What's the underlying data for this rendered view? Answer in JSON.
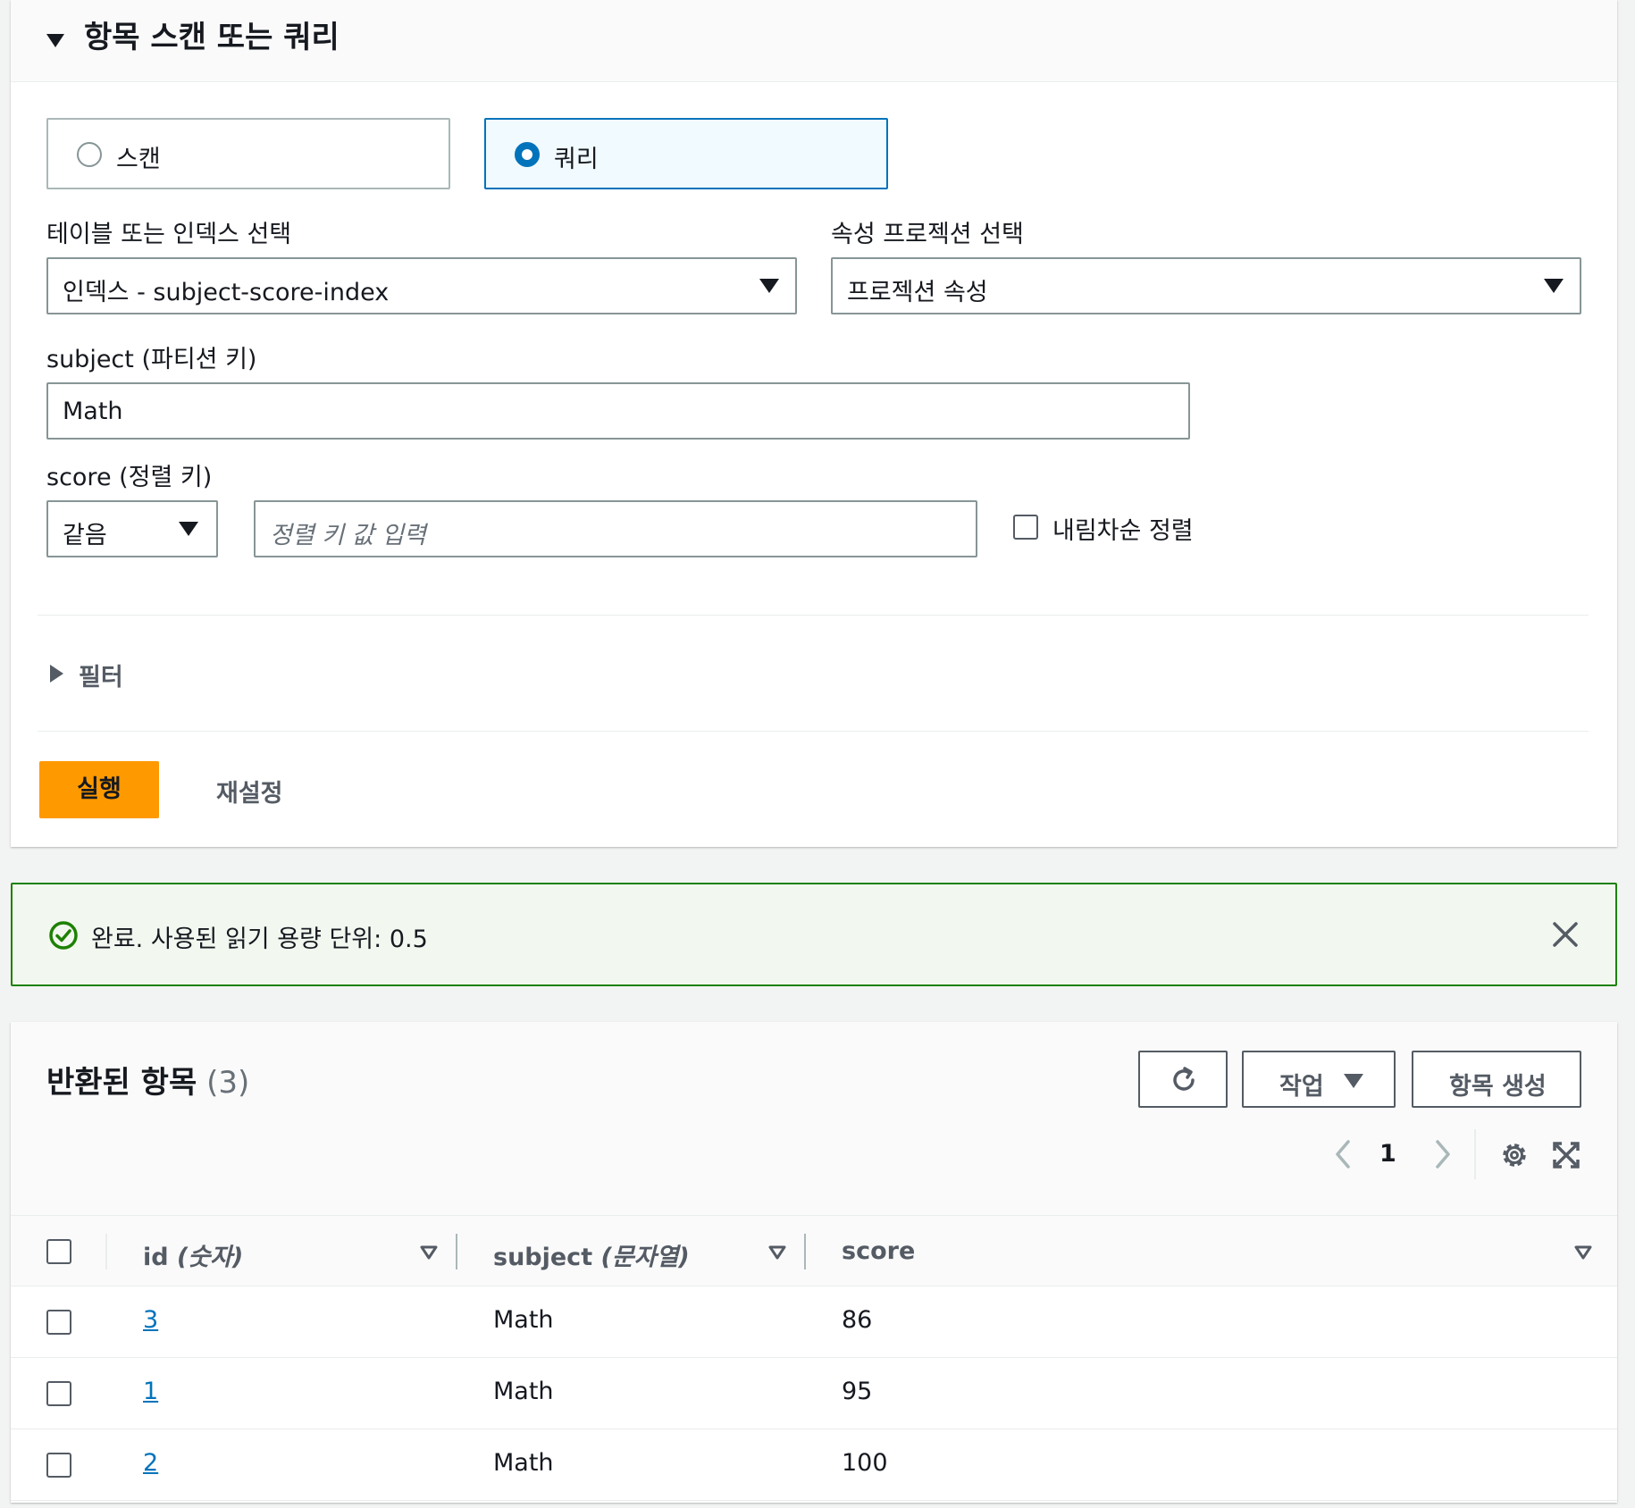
{
  "query_panel": {
    "title": "항목 스캔 또는 쿼리",
    "mode_options": [
      {
        "label": "스캔",
        "selected": false
      },
      {
        "label": "쿼리",
        "selected": true
      }
    ],
    "table_label": "테이블 또는 인덱스 선택",
    "table_value": "인덱스 - subject-score-index",
    "projection_label": "속성 프로젝션 선택",
    "projection_value": "프로젝션 속성",
    "partition_label": "subject (파티션 키)",
    "partition_value": "Math",
    "sort_label": "score (정렬 키)",
    "sort_operator": "같음",
    "sort_placeholder": "정렬 키 값 입력",
    "descending_label": "내림차순 정렬",
    "descending_checked": false,
    "filter_label": "필터",
    "run_label": "실행",
    "reset_label": "재설정"
  },
  "flash": {
    "message": "완료. 사용된 읽기 용량 단위: 0.5",
    "status_color": "#1d8102"
  },
  "results": {
    "title": "반환된 항목",
    "count": "(3)",
    "actions_label": "작업",
    "create_label": "항목 생성",
    "page": "1",
    "columns": [
      {
        "name": "id",
        "type": "(숫자)"
      },
      {
        "name": "subject",
        "type": "(문자열)"
      },
      {
        "name": "score",
        "type": ""
      }
    ],
    "rows": [
      {
        "id": "3",
        "subject": "Math",
        "score": "86"
      },
      {
        "id": "1",
        "subject": "Math",
        "score": "95"
      },
      {
        "id": "2",
        "subject": "Math",
        "score": "100"
      }
    ]
  },
  "colors": {
    "accent": "#ff9900",
    "link": "#0073bb",
    "success": "#1d8102"
  }
}
